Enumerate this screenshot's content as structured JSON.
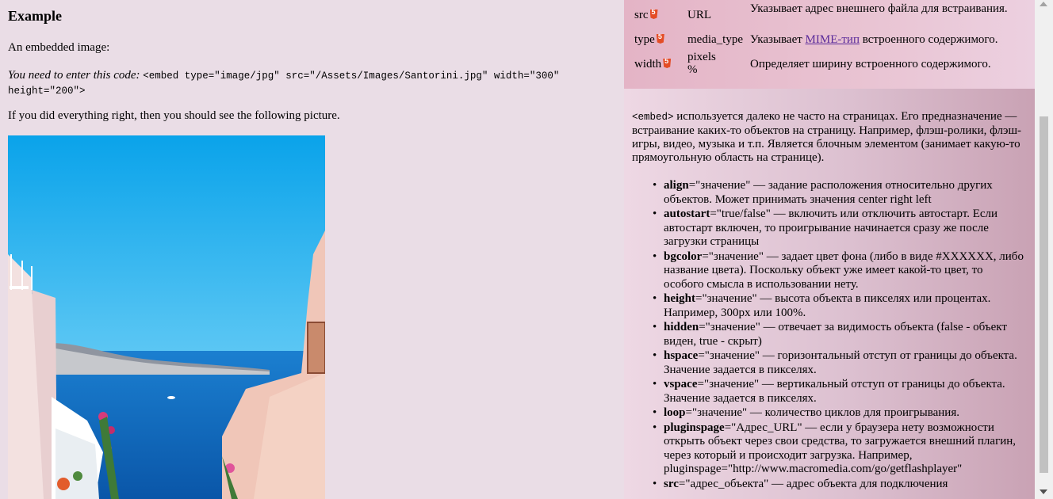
{
  "left": {
    "title": "Example",
    "intro": "An embedded image:",
    "instruction_em": "You need to enter this code:",
    "instruction_code": "<embed type=\"image/jpg\" src=\"/Assets/Images/Santorini.jpg\" width=\"300\" height=\"200\">",
    "result": "If you did everything right, then you should see the following picture."
  },
  "attributes": [
    {
      "name": "src",
      "value": "URL",
      "description": "Указывает адрес внешнего файла для встраивания."
    },
    {
      "name": "type",
      "value": "media_type",
      "description_before": "Указывает ",
      "description_link": "MIME-тип",
      "description_after": " встроенного содержимого."
    },
    {
      "name": "width",
      "value": "pixels\n%",
      "description": "Определяет ширину встроенного содержимого."
    }
  ],
  "description": {
    "intro_code": "<embed>",
    "intro_text": " используется далеко не часто на страницах. Его предназначение — встраивание каких-то объектов на страницу. Например, флэш-ролики, флэш-игры, видео, музыка и т.п. Является блочным элементом (занимает какую-то прямоугольную область на странице).",
    "items": [
      {
        "key": "align",
        "text": "=\"значение\" — задание расположения относительно других объектов. Может принимать значения center right left"
      },
      {
        "key": "autostart",
        "text": "=\"true/false\" — включить или отключить автостарт. Если автостарт включен, то проигрывание начинается сразу же после загрузки страницы"
      },
      {
        "key": "bgcolor",
        "text": "=\"значение\" — задает цвет фона (либо в виде #XXXXXX, либо название цвета). Поскольку объект уже имеет какой-то цвет, то особого смысла в использовании нету."
      },
      {
        "key": "height",
        "text": "=\"значение\" — высота объекта в пикселях или процентах. Например, 300px или 100%."
      },
      {
        "key": "hidden",
        "text": "=\"значение\" — отвечает за видимость объекта (false - объект виден, true - скрыт)"
      },
      {
        "key": "hspace",
        "text": "=\"значение\" — горизонтальный отступ от границы до объекта. Значение задается в пикселях."
      },
      {
        "key": "vspace",
        "text": "=\"значение\" — вертикальный отступ от границы до объекта. Значение задается в пикселях."
      },
      {
        "key": "loop",
        "text": "=\"значение\" — количество циклов для проигрывания."
      },
      {
        "key": "pluginspage",
        "text": "=\"Адрес_URL\" — если у браузера нету возможности открыть объект через свои средства, то загружается внешний плагин, через который и происходит загрузка. Например, pluginspage=\"http://www.macromedia.com/go/getflashplayer\""
      },
      {
        "key": "src",
        "text": "=\"адрес_объекта\" — адрес объекта для подключения"
      }
    ]
  },
  "icons": {
    "html5_badge": "html5-icon"
  },
  "colors": {
    "page_bg": "#eadde6",
    "table_bg": "#e4b4c6",
    "link": "#5a2a9a"
  }
}
